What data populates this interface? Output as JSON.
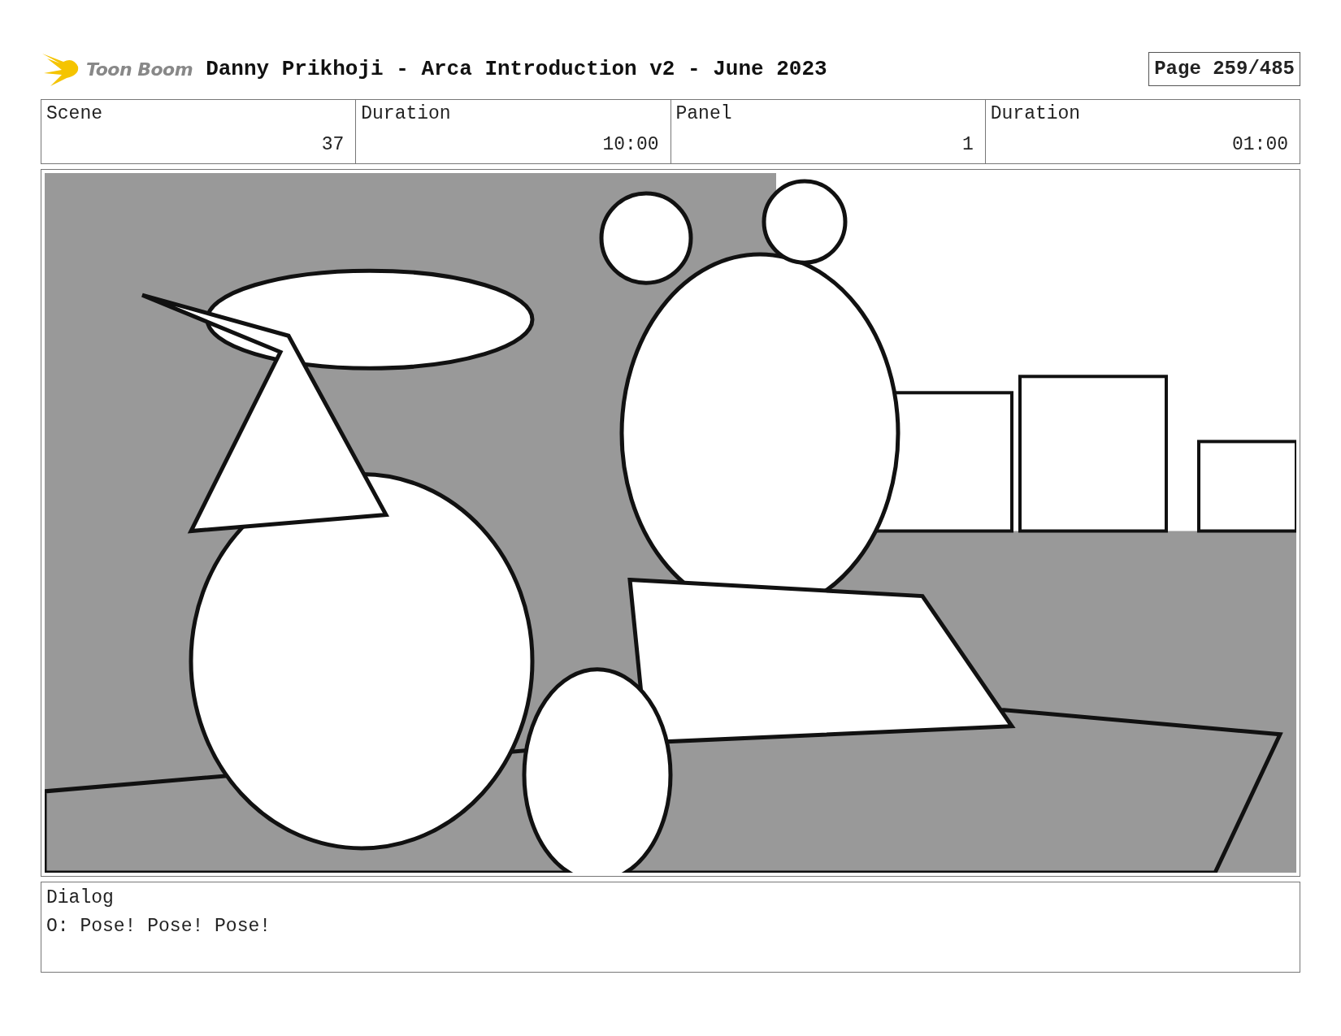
{
  "header": {
    "logo_text": "Toon Boom",
    "title": "Danny Prikhoji - Arca Introduction v2 - June 2023",
    "page": "Page 259/485"
  },
  "fields": [
    {
      "label": "Scene",
      "value": "37"
    },
    {
      "label": "Duration",
      "value": "10:00"
    },
    {
      "label": "Panel",
      "value": "1"
    },
    {
      "label": "Duration",
      "value": "01:00"
    }
  ],
  "dialog": {
    "label": "Dialog",
    "text": "O: Pose! Pose! Pose!"
  }
}
